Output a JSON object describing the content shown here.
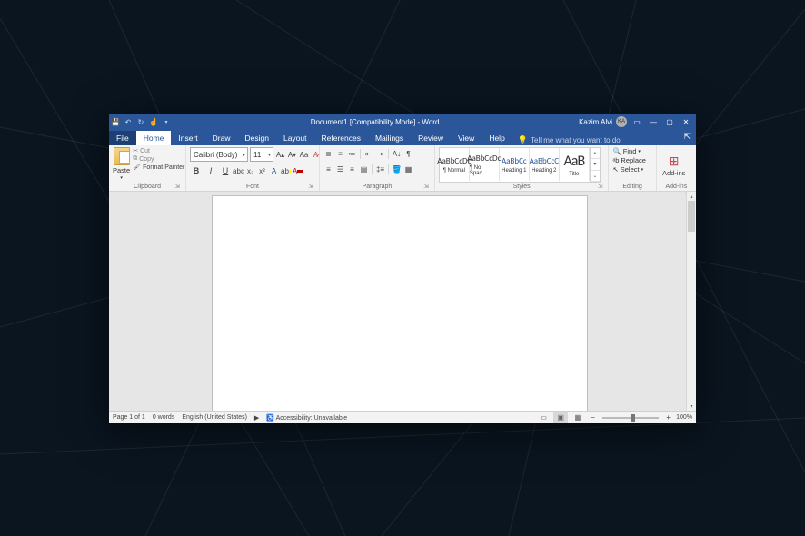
{
  "title": "Document1 [Compatibility Mode] - Word",
  "user": {
    "name": "Kazim Alvi",
    "initials": "KA"
  },
  "tabs": [
    "File",
    "Home",
    "Insert",
    "Draw",
    "Design",
    "Layout",
    "References",
    "Mailings",
    "Review",
    "View",
    "Help"
  ],
  "active_tab": "Home",
  "tell_me": "Tell me what you want to do",
  "ribbon": {
    "clipboard": {
      "label": "Clipboard",
      "paste": "Paste",
      "cut": "Cut",
      "copy": "Copy",
      "format_painter": "Format Painter"
    },
    "font": {
      "label": "Font",
      "name": "Calibri (Body)",
      "size": "11"
    },
    "paragraph": {
      "label": "Paragraph"
    },
    "styles": {
      "label": "Styles",
      "items": [
        {
          "name": "¶ Normal",
          "preview": "AaBbCcDc",
          "cls": "sp-normal"
        },
        {
          "name": "¶ No Spac...",
          "preview": "AaBbCcDc",
          "cls": "sp-normal"
        },
        {
          "name": "Heading 1",
          "preview": "AaBbCc",
          "cls": "sp-h1"
        },
        {
          "name": "Heading 2",
          "preview": "AaBbCcC",
          "cls": "sp-h2"
        },
        {
          "name": "Title",
          "preview": "AaB",
          "cls": "sp-title"
        }
      ]
    },
    "editing": {
      "label": "Editing",
      "find": "Find",
      "replace": "Replace",
      "select": "Select"
    },
    "addins": {
      "label": "Add-ins",
      "btn": "Add-ins"
    }
  },
  "status": {
    "page": "Page 1 of 1",
    "words": "0 words",
    "lang": "English (United States)",
    "accessibility": "Accessibility: Unavailable",
    "zoom": "100%"
  }
}
